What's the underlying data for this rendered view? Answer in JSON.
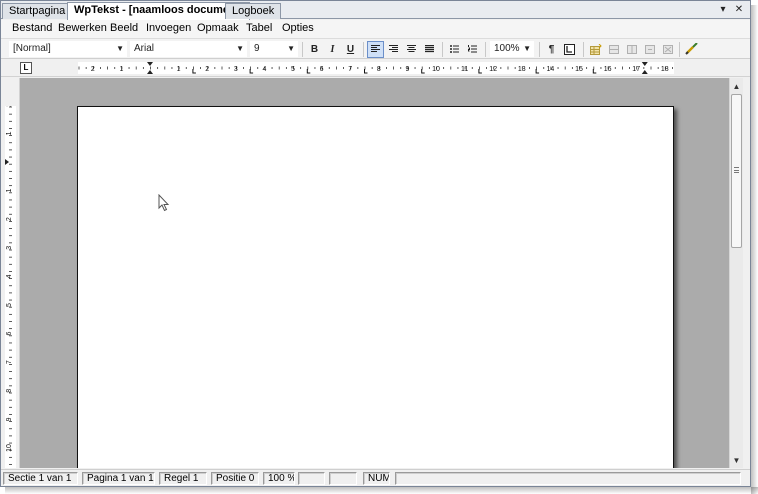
{
  "tabs": [
    {
      "label": "Startpagina",
      "active": false
    },
    {
      "label": "WpTekst - [naamloos document]",
      "active": true
    },
    {
      "label": "Logboek",
      "active": false
    }
  ],
  "tab_controls": {
    "dropdown": "▾",
    "close": "✕"
  },
  "menu": [
    "Bestand",
    "Bewerken",
    "Beeld",
    "Invoegen",
    "Opmaak",
    "Tabel",
    "Opties"
  ],
  "toolbar": {
    "style_value": "[Normal]",
    "font_value": "Arial",
    "size_value": "9",
    "bold": "B",
    "italic": "I",
    "underline": "U",
    "zoom_value": "100%",
    "pilcrow": "¶"
  },
  "ruler": {
    "corner": "L",
    "h_numbers": [
      "2",
      "1",
      "1",
      "2",
      "3",
      "4",
      "5",
      "6",
      "7",
      "8",
      "9",
      "10",
      "11",
      "12",
      "13",
      "14",
      "15",
      "16",
      "17",
      "18"
    ],
    "v_numbers": [
      "2",
      "1",
      "1",
      "2",
      "3",
      "4",
      "5",
      "6",
      "7",
      "8",
      "9",
      "10"
    ]
  },
  "statusbar": {
    "section": "Sectie 1 van 1",
    "page": "Pagina 1 van 1",
    "line": "Regel 1",
    "position": "Positie 0",
    "zoom": "100 %",
    "blank1": "",
    "blank2": "",
    "num": "NUM",
    "blank3": ""
  },
  "colors": {
    "accent": "#6b8fc9",
    "desk": "#ababab",
    "page": "#ffffff"
  }
}
